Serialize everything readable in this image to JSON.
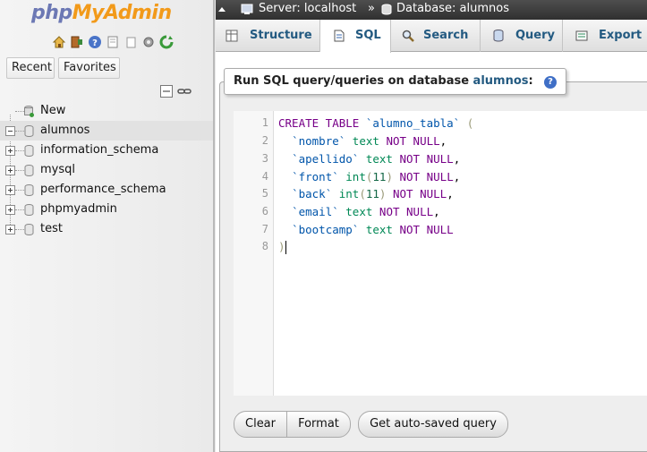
{
  "logo": {
    "part1": "php",
    "part2": "MyAdmin"
  },
  "nav": {
    "recent_label": "Recent",
    "favorites_label": "Favorites",
    "new_label": "New",
    "databases": [
      {
        "name": "alumnos",
        "expanded": true
      },
      {
        "name": "information_schema",
        "expanded": false
      },
      {
        "name": "mysql",
        "expanded": false
      },
      {
        "name": "performance_schema",
        "expanded": false
      },
      {
        "name": "phpmyadmin",
        "expanded": false
      },
      {
        "name": "test",
        "expanded": false
      }
    ]
  },
  "breadcrumb": {
    "server": "Server: localhost",
    "separator": "»",
    "database": "Database: alumnos"
  },
  "tabs": [
    {
      "label": "Structure",
      "icon": "structure-icon"
    },
    {
      "label": "SQL",
      "icon": "sql-icon",
      "active": true
    },
    {
      "label": "Search",
      "icon": "search-icon"
    },
    {
      "label": "Query",
      "icon": "query-icon"
    },
    {
      "label": "Export",
      "icon": "export-icon"
    }
  ],
  "sql_panel": {
    "legend_prefix": "Run SQL query/queries on database ",
    "legend_db": "alumnos",
    "legend_suffix": ":"
  },
  "editor": {
    "line_numbers": [
      "1",
      "2",
      "3",
      "4",
      "5",
      "6",
      "7",
      "8"
    ]
  },
  "buttons": {
    "clear": "Clear",
    "format": "Format",
    "autosave": "Get auto-saved query"
  },
  "colors": {
    "accent": "#235a81",
    "logo_php": "#6c78b4",
    "logo_myadmin": "#f29a1a",
    "keyword": "#770088",
    "backtick": "#0055aa"
  }
}
